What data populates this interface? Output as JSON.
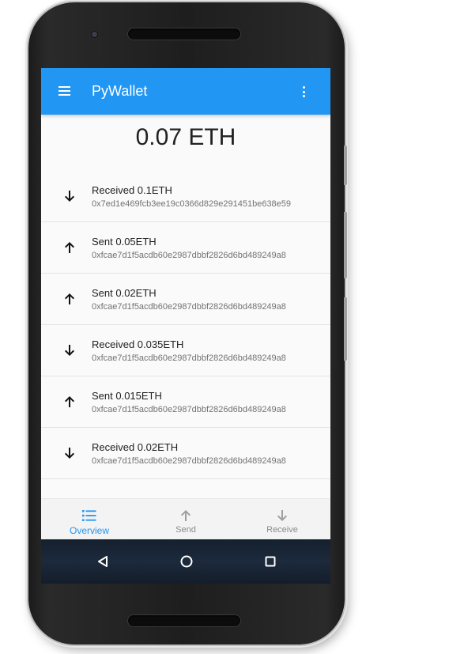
{
  "app": {
    "title": "PyWallet"
  },
  "balance": "0.07 ETH",
  "transactions": [
    {
      "direction": "received",
      "title": "Received 0.1ETH",
      "hash": "0x7ed1e469fcb3ee19c0366d829e291451be638e59"
    },
    {
      "direction": "sent",
      "title": "Sent 0.05ETH",
      "hash": "0xfcae7d1f5acdb60e2987dbbf2826d6bd489249a8"
    },
    {
      "direction": "sent",
      "title": "Sent 0.02ETH",
      "hash": "0xfcae7d1f5acdb60e2987dbbf2826d6bd489249a8"
    },
    {
      "direction": "received",
      "title": "Received 0.035ETH",
      "hash": "0xfcae7d1f5acdb60e2987dbbf2826d6bd489249a8"
    },
    {
      "direction": "sent",
      "title": "Sent 0.015ETH",
      "hash": "0xfcae7d1f5acdb60e2987dbbf2826d6bd489249a8"
    },
    {
      "direction": "received",
      "title": "Received 0.02ETH",
      "hash": "0xfcae7d1f5acdb60e2987dbbf2826d6bd489249a8"
    }
  ],
  "bottom_nav": {
    "items": [
      {
        "label": "Overview",
        "icon": "list-icon",
        "active": true
      },
      {
        "label": "Send",
        "icon": "arrow-up-icon",
        "active": false
      },
      {
        "label": "Receive",
        "icon": "arrow-down-icon",
        "active": false
      }
    ]
  },
  "system_nav": {
    "back_icon": "back-triangle-icon",
    "home_icon": "home-circle-icon",
    "recents_icon": "recents-square-icon"
  },
  "colors": {
    "primary": "#2196f3",
    "text_primary": "#212121",
    "text_secondary": "#737373",
    "nav_inactive": "#8a8a8a"
  }
}
